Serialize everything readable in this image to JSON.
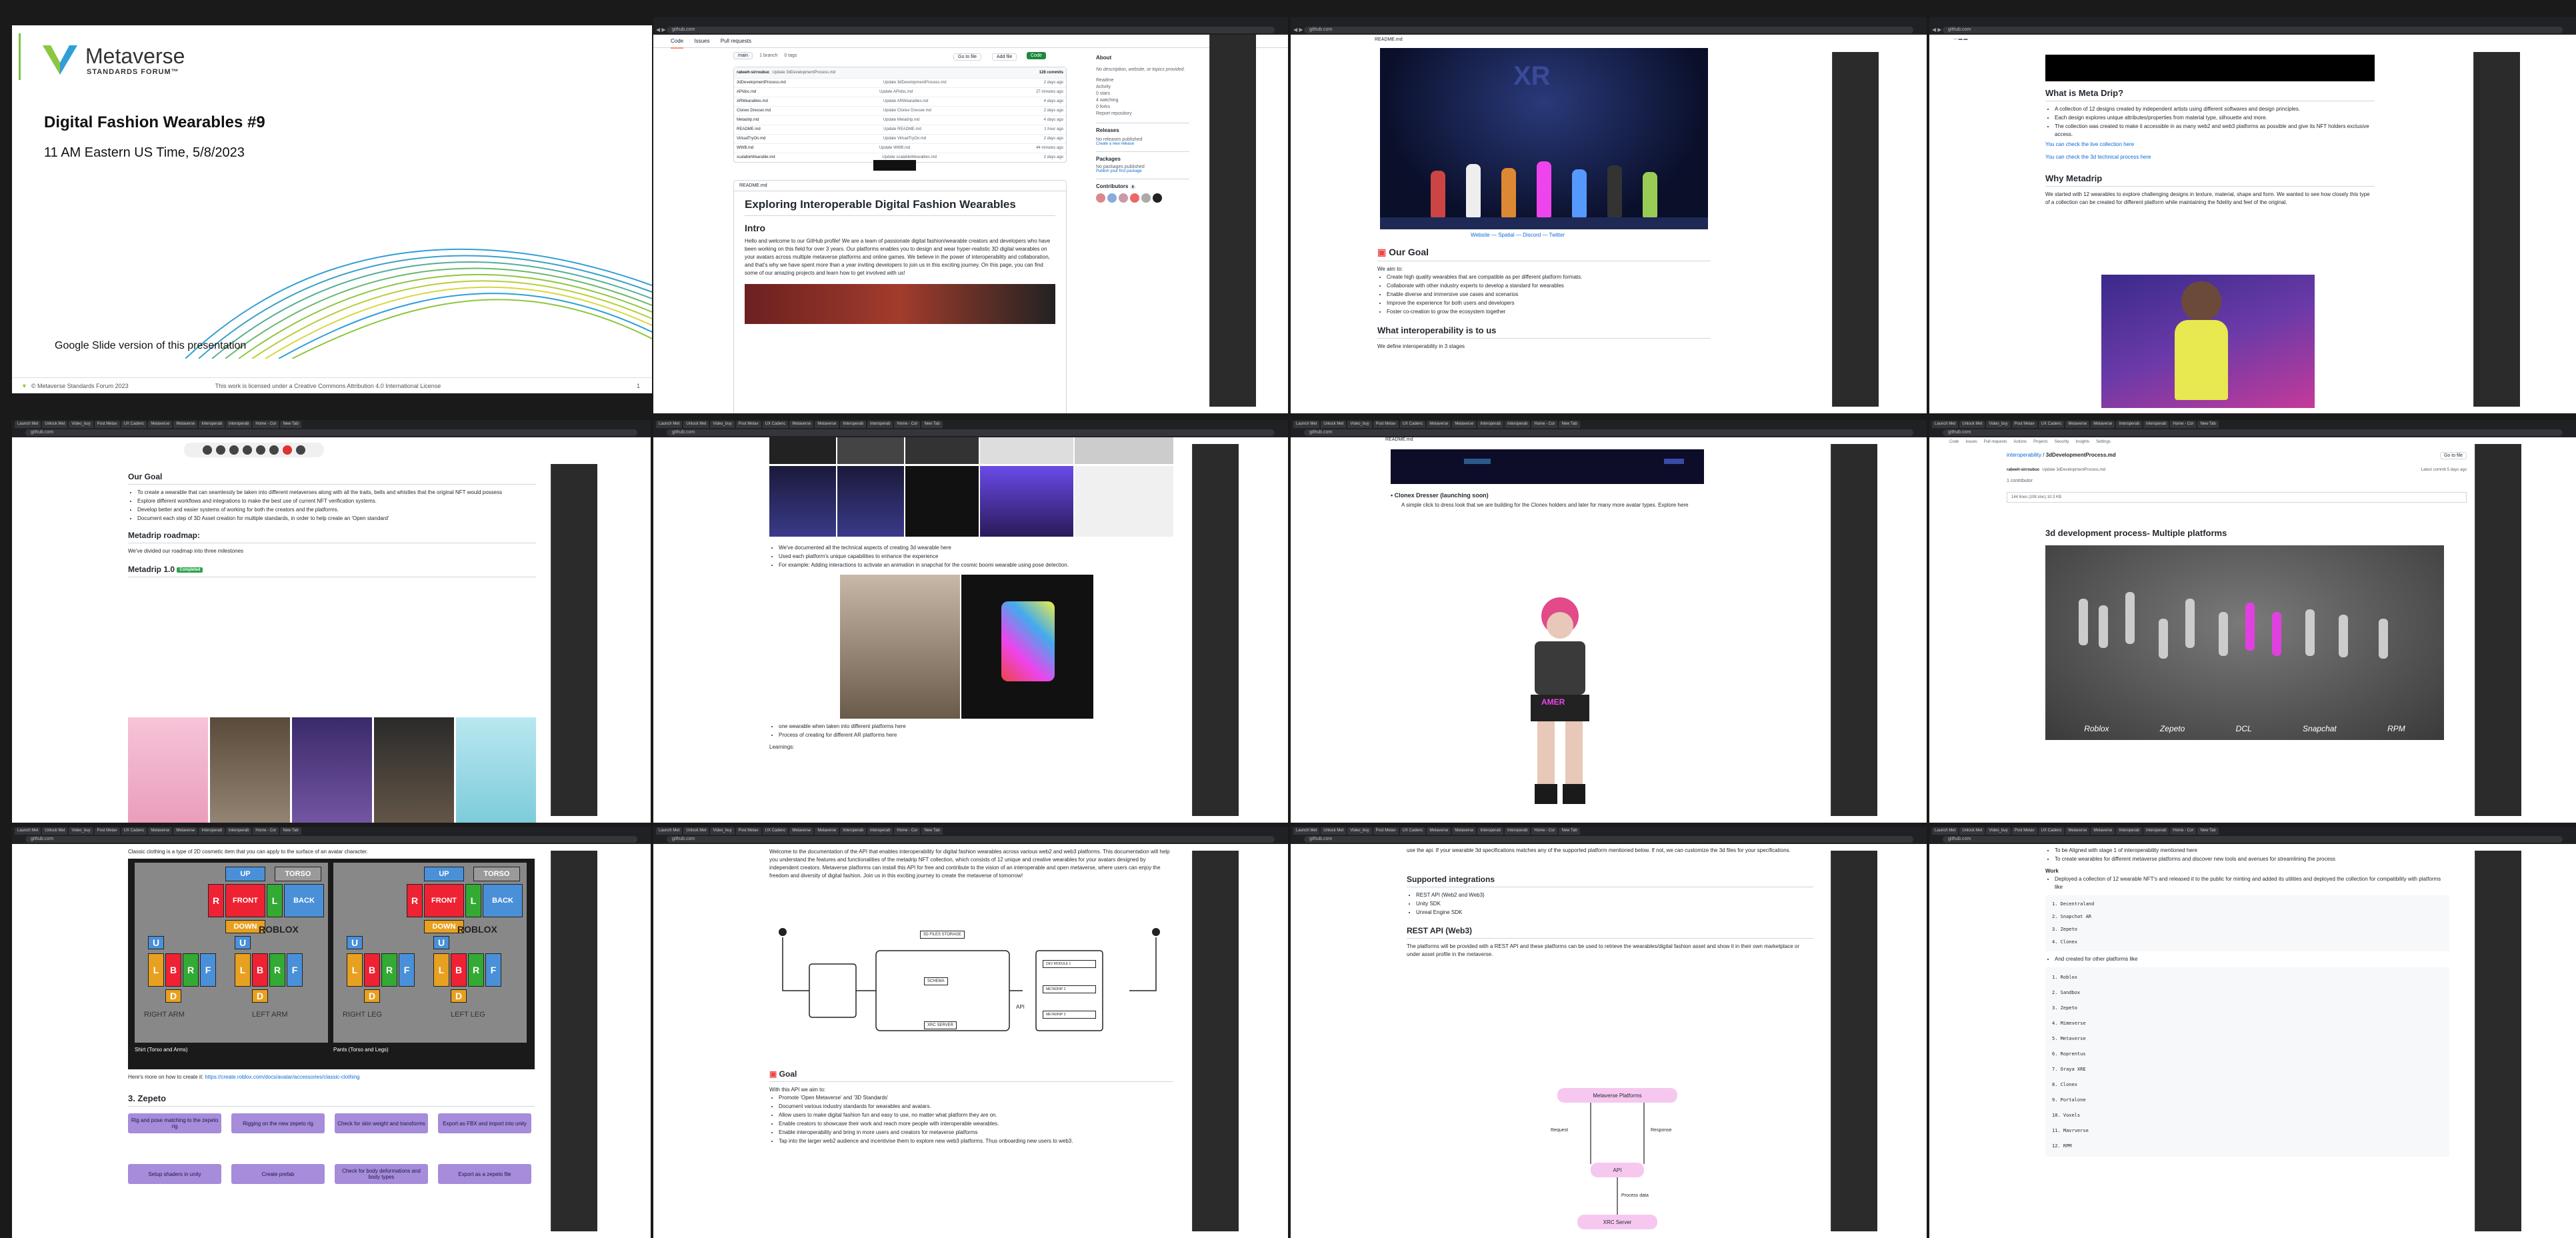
{
  "tiles": [
    {
      "id": "t1",
      "type": "slide"
    },
    {
      "id": "t2",
      "type": "github-repo"
    },
    {
      "id": "t3",
      "type": "readme-intro"
    },
    {
      "id": "t4",
      "type": "metadrip"
    },
    {
      "id": "t5",
      "type": "goal"
    },
    {
      "id": "t6",
      "type": "gallery"
    },
    {
      "id": "t7",
      "type": "avatar"
    },
    {
      "id": "t8",
      "type": "3d-process"
    },
    {
      "id": "t9",
      "type": "roblox"
    },
    {
      "id": "t10",
      "type": "api-doc"
    },
    {
      "id": "t11",
      "type": "integrations"
    },
    {
      "id": "t12",
      "type": "list"
    }
  ],
  "slide": {
    "org_name": "Metaverse",
    "org_sub": "STANDARDS FORUM™",
    "title": "Digital Fashion Wearables #9",
    "datetime": "11 AM Eastern US Time, 5/8/2023",
    "google_link": "Google Slide version of this presentation",
    "footer_left": "© Metaverse Standards Forum 2023",
    "footer_center": "This work is licensed under a Creative Commons Attribution 4.0 International License",
    "footer_page": "1"
  },
  "chrome": {
    "url": "github.com",
    "tab_labels": [
      "Launch Met",
      "Unlock Met",
      "Video_buy",
      "Post Metav",
      "UX Cadenc",
      "Metaverse",
      "Metaverse",
      "Interoperab",
      "interoperab",
      "Home - Cor",
      "New Tab"
    ]
  },
  "repo": {
    "nav_code": "Code",
    "nav_issues": "Issues",
    "nav_pulls": "Pull requests",
    "branch": "main",
    "branches": "1 branch",
    "tags": "0 tags",
    "goto": "Go to file",
    "addfile": "Add file",
    "codebtn": "Code",
    "commit_author": "rabeeh-sirroubuc",
    "commit_msg": "Update 3dDevelopmentProcess.md",
    "commits": "128 commits",
    "files": [
      {
        "name": "3dDevelopmentProcess.md",
        "msg": "Update 3dDevelopmentProcess.md",
        "age": "2 days ago"
      },
      {
        "name": "APIdoc.md",
        "msg": "Update APIdoc.md",
        "age": "27 minutes ago"
      },
      {
        "name": "ARWearables.md",
        "msg": "Update ARWearables.md",
        "age": "4 days ago"
      },
      {
        "name": "Clonex Dresser.md",
        "msg": "Update Clonex Dresser.md",
        "age": "2 days ago"
      },
      {
        "name": "Metadrip.md",
        "msg": "Update Metadrip.md",
        "age": "4 days ago"
      },
      {
        "name": "README.md",
        "msg": "Update README.md",
        "age": "1 hour ago"
      },
      {
        "name": "VirtualTryOn.md",
        "msg": "Update VirtualTryOn.md",
        "age": "2 days ago"
      },
      {
        "name": "WWB.md",
        "msg": "Update WWB.md",
        "age": "44 minutes ago"
      },
      {
        "name": "scalableWearable.md",
        "msg": "Update scalableWearables.md",
        "age": "2 days ago"
      }
    ],
    "about_title": "About",
    "about_text": "No description, website, or topics provided.",
    "about_items": [
      "Readme",
      "Activity",
      "0 stars",
      "4 watching",
      "0 forks",
      "Report repository"
    ],
    "releases_title": "Releases",
    "releases_text": "No releases published",
    "releases_link": "Create a new release",
    "packages_title": "Packages",
    "packages_text": "No packages published",
    "packages_link": "Publish your first package",
    "contributors_title": "Contributors",
    "contributors_count": "6",
    "readme_label": "README.md",
    "readme_title": "Exploring Interoperable Digital Fashion Wearables",
    "intro_title": "Intro",
    "intro_text": "Hello and welcome to our GitHub profile! We are a team of passionate digital fashion/wearable creators and developers who have been working on this field for over 3 years. Our platforms enables you to design and wear hyper-realistic 3D digital wearables on your avatars across multiple metaverse platforms and online games. We believe in the power of interoperability and collaboration, and that's why we have spent more than a year inviting developers to join us in this exciting journey. On this page, you can find some of our amazing projects and learn how to get involved with us!"
  },
  "goalpage": {
    "readme_label": "README.md",
    "links": "Website — Spatial — Discord — Twitter",
    "goal_title": "Our Goal",
    "we_aim": "We aim to:",
    "goals": [
      "Create high quality wearables that are compatible as per different platform formats.",
      "Collaborate with other industry experts to develop a standard for wearables",
      "Enable diverse and immersive use cases and scenarios",
      "Improve the experience for both users and developers",
      "Foster co-creation to grow the ecosystem together"
    ],
    "interop_title": "What interoperability is to us",
    "interop_text": "We define interoperability in 3 stages"
  },
  "metadrip": {
    "what_title": "What is Meta Drip?",
    "what_items": [
      "A collection of 12 designs created by independent artists using different softwares and design principles.",
      "Each design explores unique attributes/properties from material type, silhouette and more.",
      "The collection was created to make it accessible in as many web2 and web3 platforms as possible and give its NFT holders exclusive access."
    ],
    "link1": "You can check the live collection here",
    "link2": "You can check the 3d technical process here",
    "why_title": "Why Metadrip",
    "why_text": "We started with 12 wearables to explore challenging designs in texture, material, shape and form. We wanted to see how closely this type of a collection can be created for different platform while maintaining the fidelity and feel of the original."
  },
  "goal2": {
    "title": "Our Goal",
    "items": [
      "To create a wearable that can seamlessly be taken into different metaverses along with all the traits, bells and whistles that the original NFT would possess",
      "Explore different workflows and integrations to make the best use of current NFT verification systems.",
      "Develop better and easier systems of working for both the creators and the platforms.",
      "Document each step of 3D Asset creation for multiple standards, in order to help create an 'Open standard'"
    ],
    "roadmap_title": "Metadrip roadmap:",
    "roadmap_text": "We've divided our roadmap into three milestones",
    "v1_title": "Metadrip 1.0",
    "v1_badge": "Completed"
  },
  "gallery": {
    "items": [
      "We've documented all the technical aspects of creating 3d wearable here",
      "Used each platform's unique capabilities to enhance the experience",
      "For example: Adding interactions to activate an animation in snapchat for the cosmic boomi wearable using pose detection."
    ],
    "items2": [
      "one wearable when taken into different platforms here",
      "Process of creating for different AR platforms here"
    ],
    "learnings": "Learnings:"
  },
  "clonex": {
    "readme_label": "README.md",
    "title": "Clonex Dresser (launching soon)",
    "sub": "A simple click to dress look that we are building for the Clonex holders and later for many more avatar types. Explore here"
  },
  "process": {
    "breadcrumb_repo": "interoperability",
    "breadcrumb_file": "3dDevelopmentProcess.md",
    "goto": "Go to file",
    "commit_author": "rabeeh-sirroubuc",
    "commit_msg": "Update 3dDevelopmentProcess.md",
    "commit_time": "Latest commit 5 days ago",
    "contributor": "1 contributor",
    "lines": "144 lines (108 sloc)   10.3 KB",
    "title": "3d development process- Multiple platforms",
    "labels": [
      "Roblox",
      "Zepeto",
      "DCL",
      "Snapchat",
      "RPM"
    ],
    "tabs": [
      "Code",
      "Issues",
      "Pull requests",
      "Actions",
      "Projects",
      "Security",
      "Insights",
      "Settings"
    ]
  },
  "roblox": {
    "intro": "Classic clothing is a type of 2D cosmetic item that you can apply to the surface of an avatar character.",
    "cap_left": "Shirt (Torso and Arms)",
    "cap_right": "Pants (Torso and Legs)",
    "more": "Here's more on how to create it:",
    "more_link": "https://create.roblox.com/docs/avatar/accessories/classic-clothing",
    "zepeto_title": "3. Zepeto",
    "flow_row1": [
      "Rig and pose matching to the zepeto rig",
      "Rigging on the new zepeto rig",
      "Check for skin weight and transforms",
      "Export as FBX and import into unity"
    ],
    "flow_row2": [
      "Setup shaders in unity",
      "Create prefab",
      "Check for body deformations and body types",
      "Export as a zepeto file"
    ],
    "labels": {
      "up": "UP",
      "torso": "TORSO",
      "r": "R",
      "front": "FRONT",
      "l": "L",
      "back": "BACK",
      "down": "DOWN",
      "u": "U",
      "b": "B",
      "f": "F",
      "d": "D",
      "right_arm": "RIGHT ARM",
      "left_arm": "LEFT ARM",
      "right_leg": "RIGHT LEG",
      "left_leg": "LEFT LEG",
      "roblox": "ROBLOX"
    }
  },
  "apidoc": {
    "intro": "Welcome to the documentation of the API that enables interoperability for digital fashion wearables across various web2 and web3 platforms. This documentation will help you understand the features and functionalities of the metadrip NFT collection, which consists of 12 unique and creative wearables for your avatars designed by independent creators. Metaverse platforms can install this API for free and contribute to the vision of an interoperable and open metaverse, where users can enjoy the freedom and diversity of digital fashion. Join us in this exciting journey to create the metaverse of tomorrow!",
    "diagram": {
      "storage": "3D FILES STORAGE",
      "schema": "SCHEMA",
      "xrc": "XRC SERVER",
      "api": "API",
      "dev1": "DEV MODULE 1",
      "dev2": "METADRIP 2",
      "dev3": "METADRIP 3"
    },
    "goal_title": "Goal",
    "goal_intro": "With this API we aim to:",
    "goals": [
      "Promote 'Open Metaverse' and '3D Standards'",
      "Document various industry standards for wearables and avatars.",
      "Allow users to make digital fashion fun and easy to use, no matter what platform they are on.",
      "Enable creators to showcase their work and reach more people with interoperable wearables.",
      "Enable interoperability and bring in more users and creators for metaverse platforms",
      "Tap into the larger web2 audience and incentivise them to explore new web3 platforms. Thus onboarding new users to web3."
    ]
  },
  "integrations": {
    "top_text": "use the api. If your wearable 3d specifications matches any of the supported platform mentioned below. If not, we can customize the 3d files for your specifications.",
    "supported_title": "Supported integrations",
    "supported": [
      "REST API (Web2 and Web3)",
      "Unity SDK",
      "Unreal Engine SDK"
    ],
    "rest_title": "REST API (Web3)",
    "rest_text": "The platforms will be provided with a REST API and these platforms can be used to retrieve the wearables/digital fashion asset and show it in their own marketplace or under asset profile in the metaverse.",
    "diag": {
      "platforms": "Metaverse Platforms",
      "request": "Request",
      "response": "Response",
      "api": "API",
      "process": "Process data",
      "xrc": "XRC Server"
    }
  },
  "listpage": {
    "top1": "To be Aligned with stage 1 of interoperability mentioned here",
    "top2": "To create wearables for different metaverse platforms and discover new tools and avenues for streamlining the process",
    "work": "Work",
    "work_item": "Deployed a collection of 12 wearable NFT's and released it to the public for minting and added its utilities and deployed the collection for compatibility with platforms like",
    "list1": [
      "Decentraland",
      "Snapchat AR",
      "Zepeto",
      "Clonex"
    ],
    "work2": "And created for other platforms like",
    "list2": [
      "Roblox",
      "Sandbox",
      "Zepeto",
      "Mimeverse",
      "Metaverse",
      "Roprentus",
      "Oraya XRE",
      "Clonex",
      "Portalone",
      "Voxels",
      "Mavrverse",
      "RPM"
    ]
  }
}
